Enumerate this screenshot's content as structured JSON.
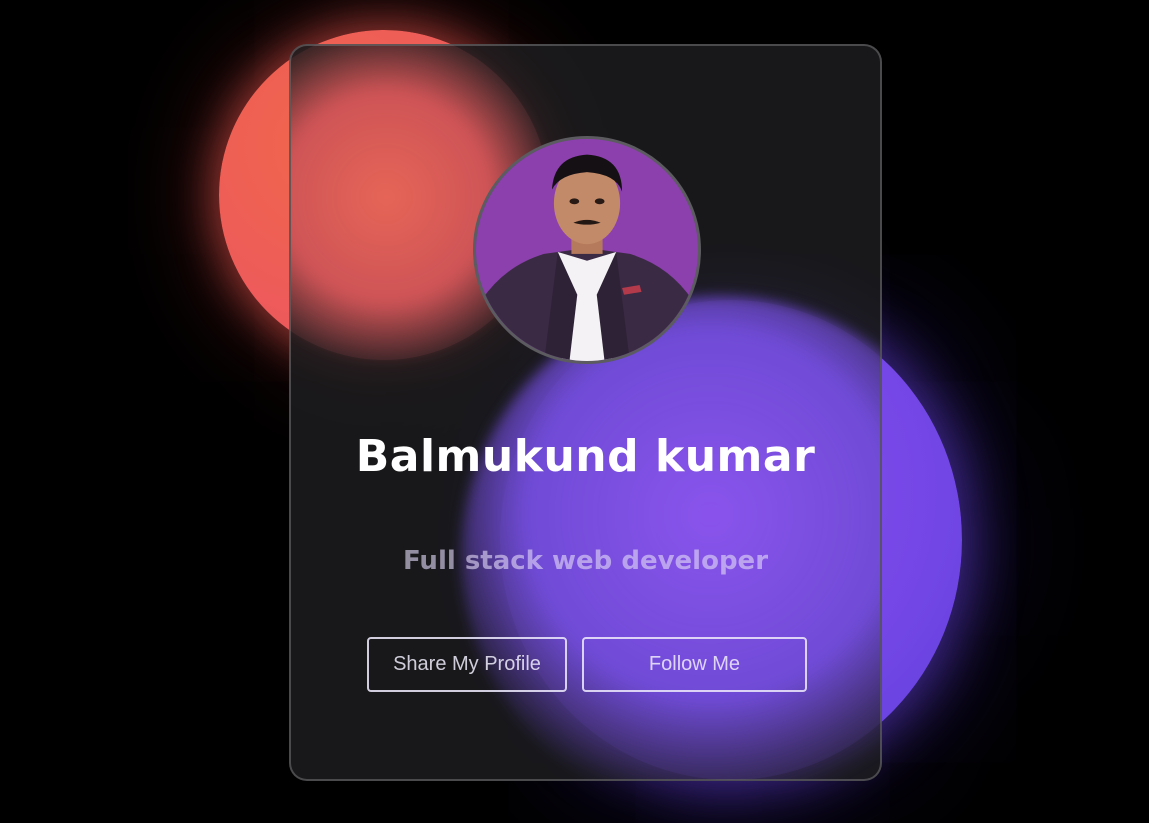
{
  "profile": {
    "name": "Balmukund kumar",
    "role": "Full stack web developer",
    "avatar_icon": "profile-photo"
  },
  "actions": {
    "share_label": "Share My Profile",
    "follow_label": "Follow Me"
  },
  "colors": {
    "background": "#000000",
    "orb_red": "#ee5b5a",
    "orb_purple": "#7547e6",
    "card": "#1c1c1e",
    "text": "#ffffff"
  }
}
